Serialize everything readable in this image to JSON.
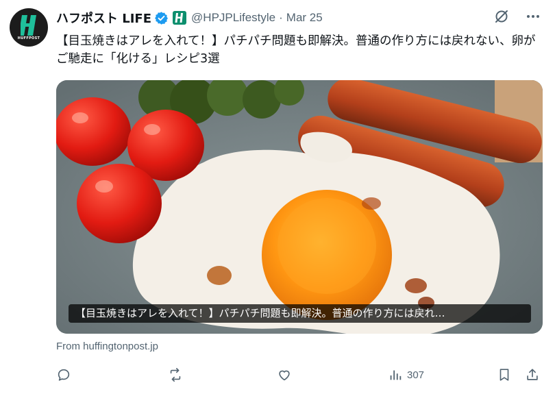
{
  "post": {
    "avatar_label": "HUFFPOST",
    "display_name": "ハフポスト LIFE",
    "handle": "@HPJPLifestyle",
    "separator": "·",
    "date": "Mar 25",
    "text": "【目玉焼きはアレを入れて！】パチパチ問題も即解決。普通の作り方には戻れない、卵がご馳走に「化ける」レシピ3選",
    "media_caption": "【目玉焼きはアレを入れて！】パチパチ問題も即解決。普通の作り方には戻れ…",
    "link_source": "From huffingtonpost.jp"
  },
  "actions": {
    "views": "307"
  },
  "icons": [
    "grok-icon",
    "more-icon",
    "verified-icon",
    "affiliate-badge-icon",
    "reply-icon",
    "repost-icon",
    "like-icon",
    "views-icon",
    "bookmark-icon",
    "share-icon"
  ],
  "colors": {
    "verified": "#1d9bf0",
    "affiliate": "#0c8f6e",
    "muted": "#536471",
    "text": "#0f1419"
  }
}
